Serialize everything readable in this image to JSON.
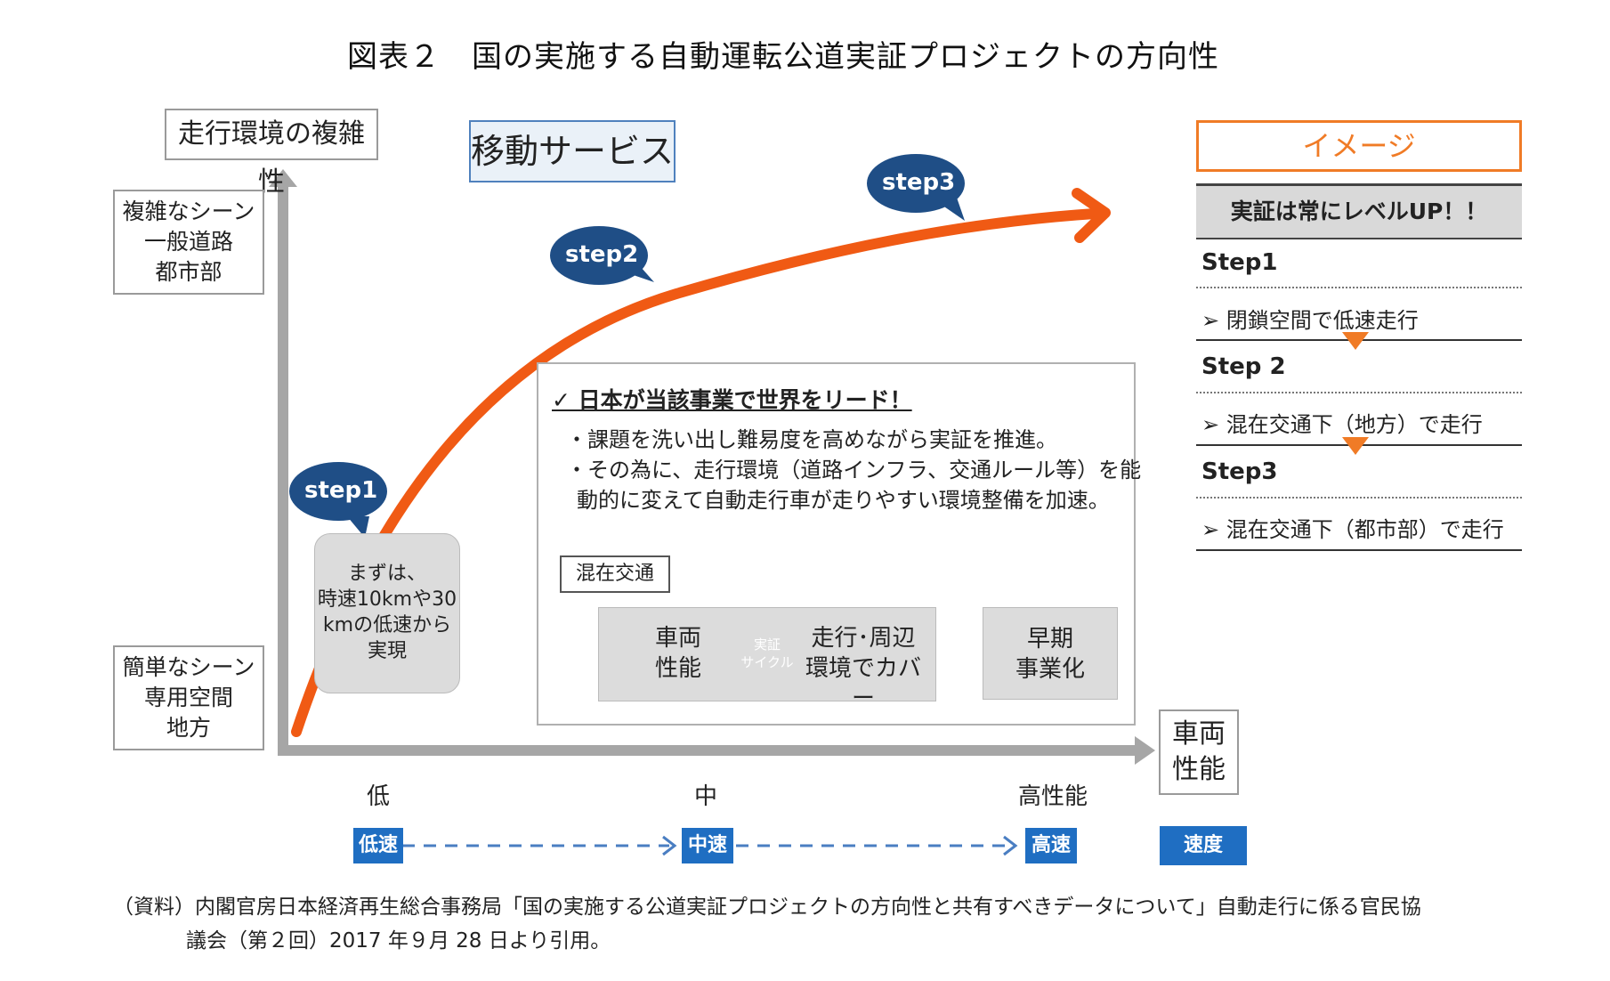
{
  "title": "図表２　国の実施する自動運転公道実証プロジェクトの方向性",
  "y_axis": {
    "title": "走行環境の複雑性",
    "top_lines": [
      "複雑なシーン",
      "一般道路",
      "都市部"
    ],
    "bottom_lines": [
      "簡単なシーン",
      "専用空間",
      "地方"
    ]
  },
  "x_axis": {
    "title_lines": [
      "車両",
      "性能"
    ],
    "levels": [
      "低",
      "中",
      "高性能"
    ],
    "speed_tags": [
      "低速",
      "中速",
      "高速"
    ],
    "speed_label": "速度"
  },
  "service_label": "移動サービス",
  "bubbles": [
    "step1",
    "step2",
    "step3"
  ],
  "first_note_lines": [
    "まずは、",
    "時速10kmや30",
    "kmの低速から",
    "実現"
  ],
  "center_panel": {
    "lead": "✓ 日本が当該事業で世界をリード！",
    "bullet1": "・課題を洗い出し難易度を高めながら実証を推進。",
    "bullet2_line1": "・その為に、走行環境（道路インフラ、交通ルール等）を能",
    "bullet2_line2": "動的に変えて自動走行車が走りやすい環境整備を加速。",
    "tag": "混在交通",
    "box1_lines": [
      "車両",
      "性能"
    ],
    "cycle_lines": [
      "実証",
      "サイクル"
    ],
    "box2_lines": [
      "走行･周辺",
      "環境でカバー"
    ],
    "box3_lines": [
      "早期",
      "事業化"
    ]
  },
  "image_panel": {
    "header": "イメージ",
    "levelup": "実証は常にレベルUP！！",
    "steps": [
      {
        "label": "Step1",
        "item": "➢ 閉鎖空間で低速走行"
      },
      {
        "label": "Step 2",
        "item": "➢ 混在交通下（地方）で走行"
      },
      {
        "label": "Step3",
        "item": "➢ 混在交通下（都市部）で走行"
      }
    ]
  },
  "source_line1": "（資料）内閣官房日本経済再生総合事務局「国の実施する公道実証プロジェクトの方向性と共有すべきデータについて」自動走行に係る官民協",
  "source_line2": "議会（第２回）2017 年９月 28 日より引用。",
  "colors": {
    "curve": "#f05a14",
    "bubble": "#1f4e86",
    "axis": "#a6a6a6",
    "speed_tag": "#1f6ec2",
    "accent_orange": "#f07b26",
    "cycle_blue": "#1f6ec2"
  }
}
